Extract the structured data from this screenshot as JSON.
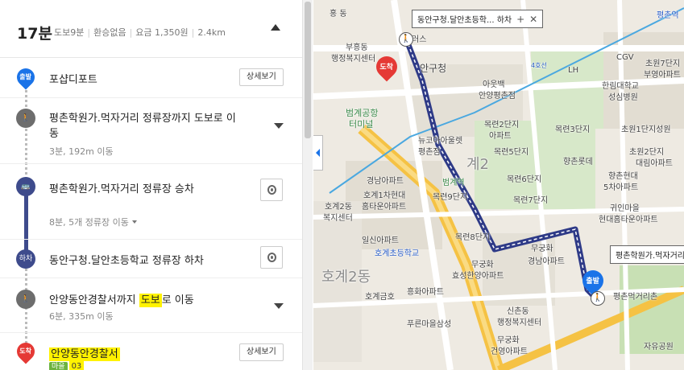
{
  "summary": {
    "time": "17분",
    "walk": "도보9분",
    "transfer": "환승없음",
    "fare": "요금 1,350원",
    "distance": "2.4km"
  },
  "steps": [
    {
      "id": "start",
      "marker": "출발",
      "title": "포샵디포트",
      "button": "상세보기"
    },
    {
      "id": "walk1",
      "title_line1": "평촌학원가.먹자거리 정류장까지 도보로 이",
      "title_line2": "동",
      "sub": "3분, 192m 이동"
    },
    {
      "id": "board",
      "title": "평촌학원가.먹자거리 정류장 승차",
      "bus_tag": "마을",
      "bus_number": "03",
      "sub": "8분, 5개 정류장 이동"
    },
    {
      "id": "alight",
      "marker": "하차",
      "title": "동안구청.달안초등학교 정류장 하차"
    },
    {
      "id": "walk2",
      "title_prefix": "안양동안경찰서까지 ",
      "title_highlight": "도보",
      "title_suffix": "로 이동",
      "sub": "6분, 335m 이동"
    },
    {
      "id": "end",
      "marker": "도착",
      "title": "안양동안경찰서",
      "button": "상세보기"
    }
  ],
  "map": {
    "bubble_top": "동안구청.달안초등학... 하차",
    "bubble_bottom": "평촌학원가.먹자거리 정류장",
    "pin_arrive": "도착",
    "pin_depart": "출발",
    "labels": [
      "홍 동",
      "부흥동",
      "행정복지센터",
      "러스",
      "안구청",
      "아웃백",
      "안양평촌점",
      "CGV",
      "LH",
      "한림대학교",
      "성심병원",
      "초원7단지",
      "부영아파트",
      "범계공항",
      "터미널",
      "뉴코아아울렛",
      "평촌점",
      "목련2단지",
      "아파트",
      "목련5단지",
      "목련6단지",
      "목련3단지",
      "향촌롯데",
      "향촌현대",
      "5차아파트",
      "초원1단지성원",
      "초원2단지",
      "대림아파트",
      "경남아파트",
      "호계1차현대",
      "홈타운아파트",
      "호계2동",
      "복지센터",
      "범계역",
      "목련9단지",
      "목련7단지",
      "귀인마을",
      "현대홈타운아파트",
      "일신아파트",
      "호계초등학교",
      "무궁화",
      "효성한양아파트",
      "목련8단지",
      "무궁화",
      "경남아파트",
      "호계금호",
      "흥화아파트",
      "푸른마을삼성",
      "신촌동",
      "행정복지센터",
      "무궁화",
      "건영아파트",
      "평촌먹거리촌",
      "자유공원",
      "평촌역",
      "4호선",
      "호계2동",
      "계2"
    ]
  },
  "colors": {
    "route": "#2e3a87",
    "bus_line": "#3e4b8c",
    "pin_blue": "#1a73e8",
    "pin_red": "#e53935",
    "highlight": "#fff200",
    "road_main": "#f5c244"
  }
}
